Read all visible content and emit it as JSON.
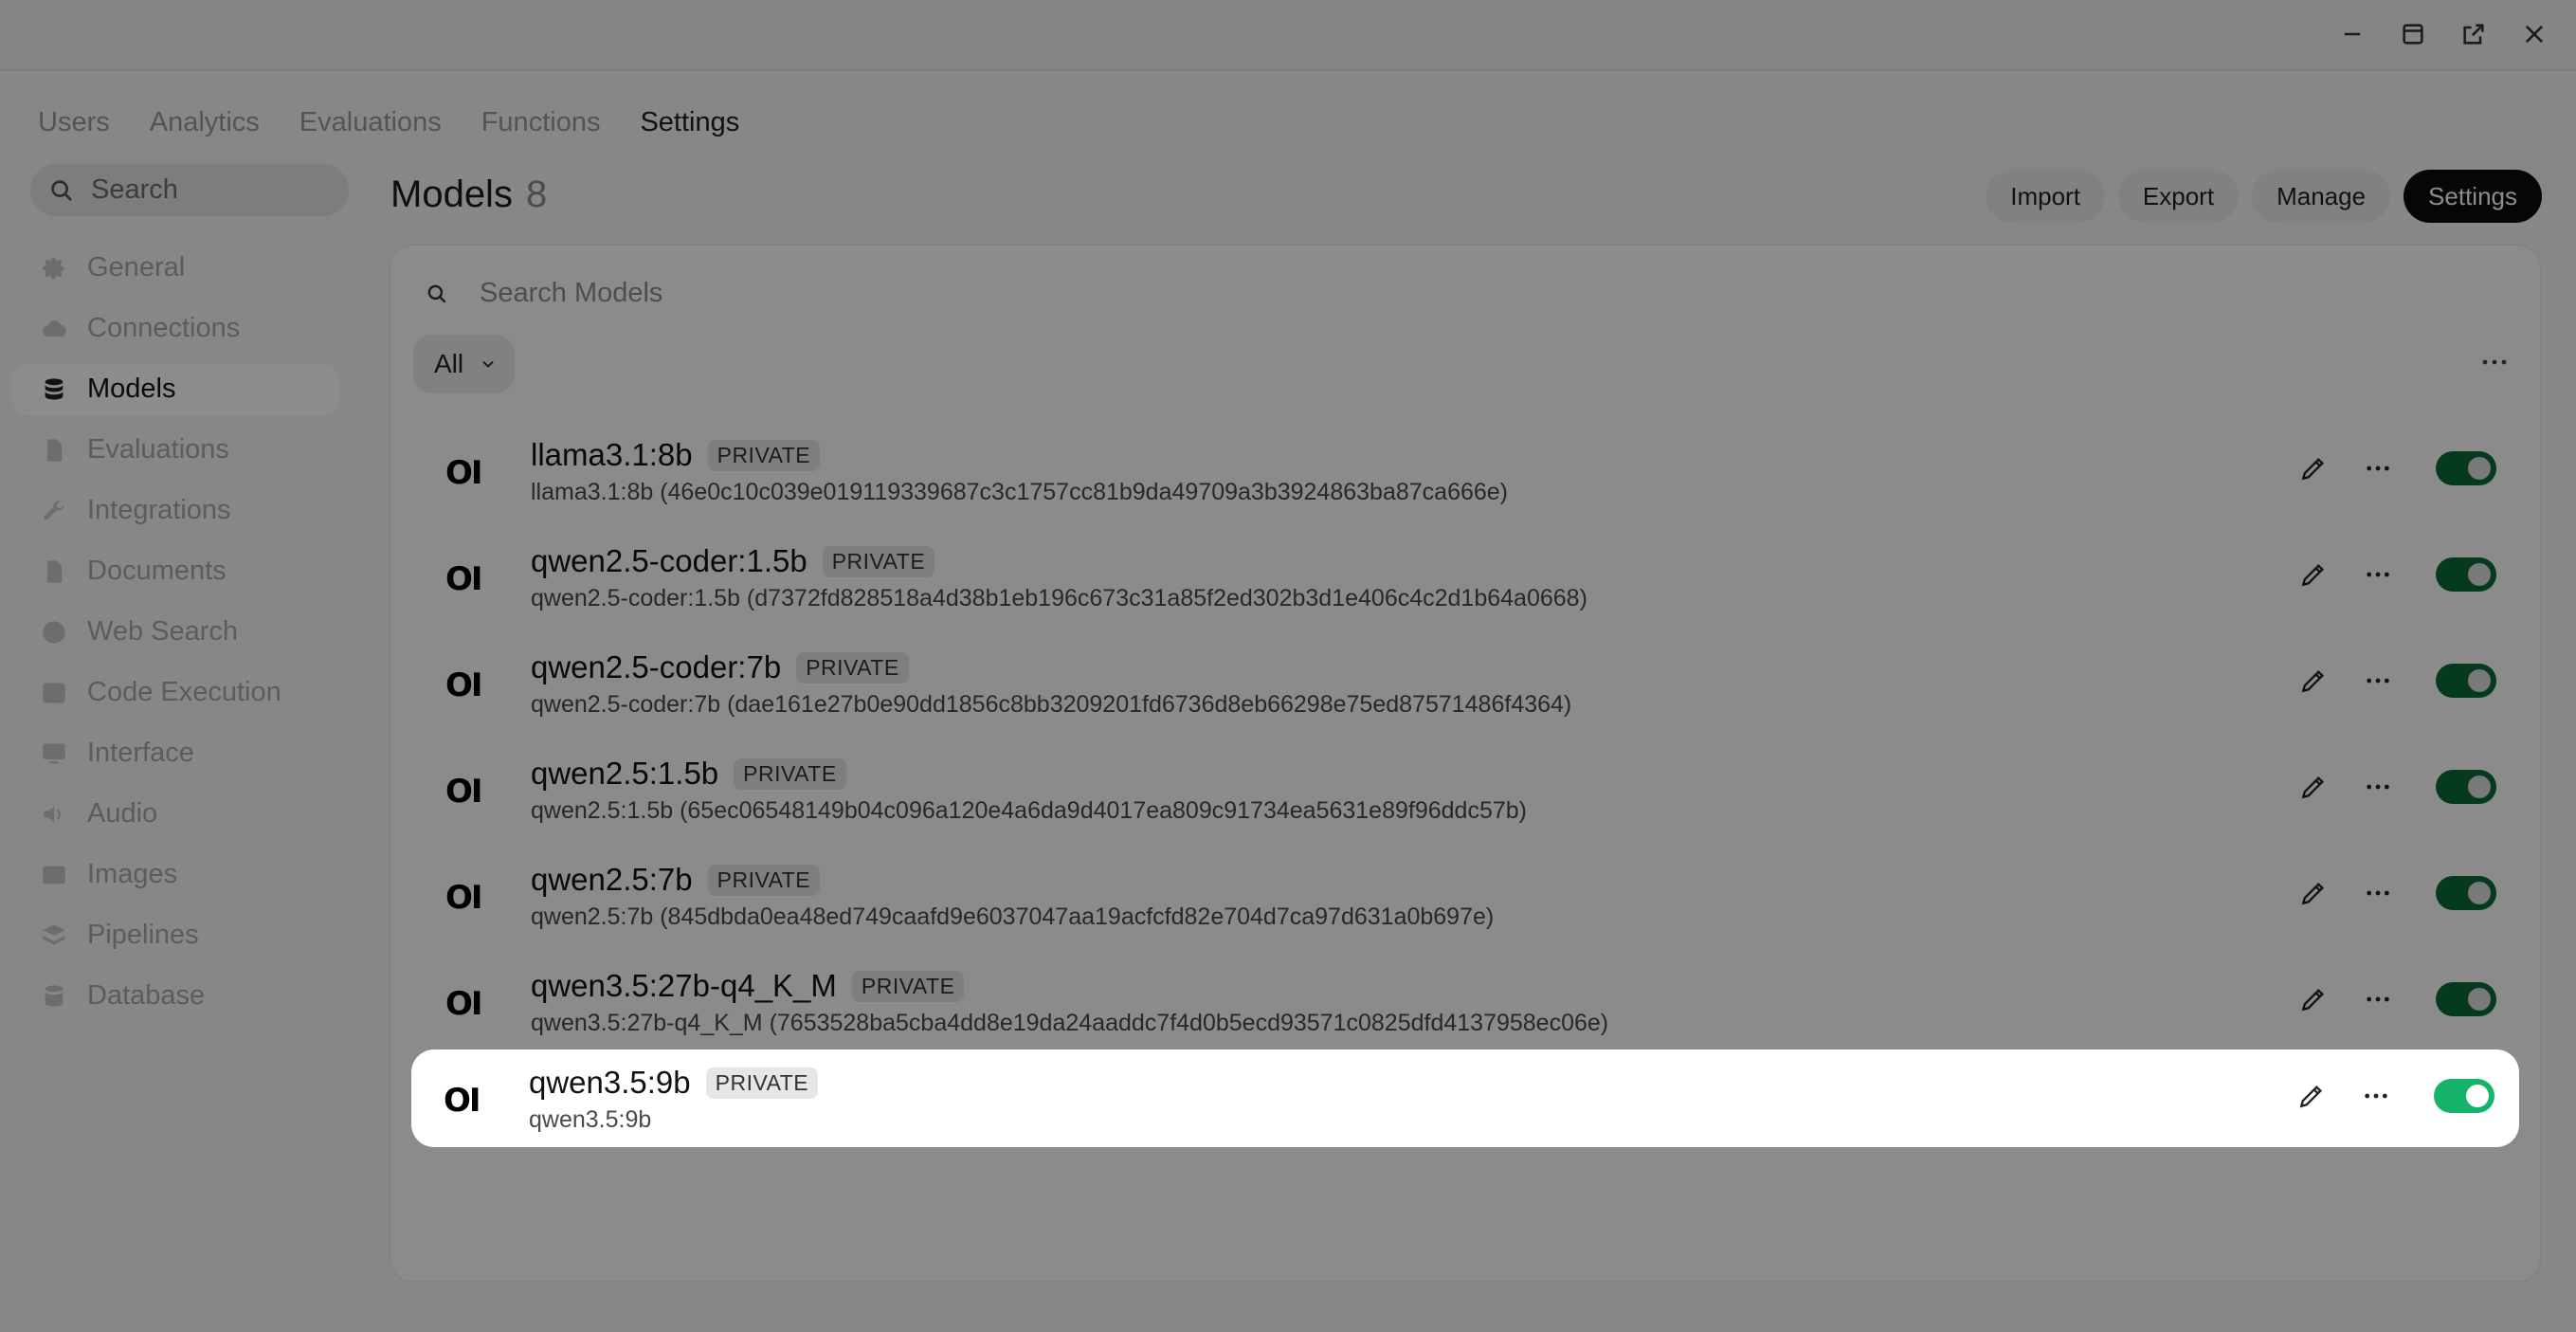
{
  "window": {
    "controls": [
      "minimize-icon",
      "maximize-icon",
      "popout-icon",
      "close-icon"
    ]
  },
  "topnav": {
    "items": [
      "Users",
      "Analytics",
      "Evaluations",
      "Functions",
      "Settings"
    ],
    "active": "Settings"
  },
  "sidebar": {
    "search_placeholder": "Search",
    "items": [
      {
        "label": "General",
        "icon": "gear-icon"
      },
      {
        "label": "Connections",
        "icon": "cloud-icon"
      },
      {
        "label": "Models",
        "icon": "database-icon"
      },
      {
        "label": "Evaluations",
        "icon": "document-icon"
      },
      {
        "label": "Integrations",
        "icon": "wrench-icon"
      },
      {
        "label": "Documents",
        "icon": "document-icon"
      },
      {
        "label": "Web Search",
        "icon": "globe-icon"
      },
      {
        "label": "Code Execution",
        "icon": "terminal-icon"
      },
      {
        "label": "Interface",
        "icon": "monitor-icon"
      },
      {
        "label": "Audio",
        "icon": "speaker-icon"
      },
      {
        "label": "Images",
        "icon": "image-icon"
      },
      {
        "label": "Pipelines",
        "icon": "layers-icon"
      },
      {
        "label": "Database",
        "icon": "database-icon"
      }
    ],
    "active": "Models"
  },
  "main": {
    "title": "Models",
    "count": "8",
    "actions": {
      "import": "Import",
      "export": "Export",
      "manage": "Manage",
      "settings": "Settings"
    },
    "search_placeholder": "Search Models",
    "filter_value": "All",
    "models": [
      {
        "name": "llama3.1:8b",
        "badge": "PRIVATE",
        "sub": "llama3.1:8b (46e0c10c039e019119339687c3c1757cc81b9da49709a3b3924863ba87ca666e)",
        "enabled": true
      },
      {
        "name": "qwen2.5-coder:1.5b",
        "badge": "PRIVATE",
        "sub": "qwen2.5-coder:1.5b (d7372fd828518a4d38b1eb196c673c31a85f2ed302b3d1e406c4c2d1b64a0668)",
        "enabled": true
      },
      {
        "name": "qwen2.5-coder:7b",
        "badge": "PRIVATE",
        "sub": "qwen2.5-coder:7b (dae161e27b0e90dd1856c8bb3209201fd6736d8eb66298e75ed87571486f4364)",
        "enabled": true
      },
      {
        "name": "qwen2.5:1.5b",
        "badge": "PRIVATE",
        "sub": "qwen2.5:1.5b (65ec06548149b04c096a120e4a6da9d4017ea809c91734ea5631e89f96ddc57b)",
        "enabled": true
      },
      {
        "name": "qwen2.5:7b",
        "badge": "PRIVATE",
        "sub": "qwen2.5:7b (845dbda0ea48ed749caafd9e6037047aa19acfcfd82e704d7ca97d631a0b697e)",
        "enabled": true
      },
      {
        "name": "qwen3.5:27b-q4_K_M",
        "badge": "PRIVATE",
        "sub": "qwen3.5:27b-q4_K_M (7653528ba5cba4dd8e19da24aaddc7f4d0b5ecd93571c0825dfd4137958ec06e)",
        "enabled": true
      },
      {
        "name": "qwen3.5:9b",
        "badge": "PRIVATE",
        "sub": "qwen3.5:9b",
        "enabled": true
      }
    ],
    "logo_text": "OI"
  },
  "colors": {
    "toggle_on": "#16b36a",
    "toggle_on_dim": "#0b6b3a",
    "overlay": "rgba(0,0,0,0.45)"
  }
}
